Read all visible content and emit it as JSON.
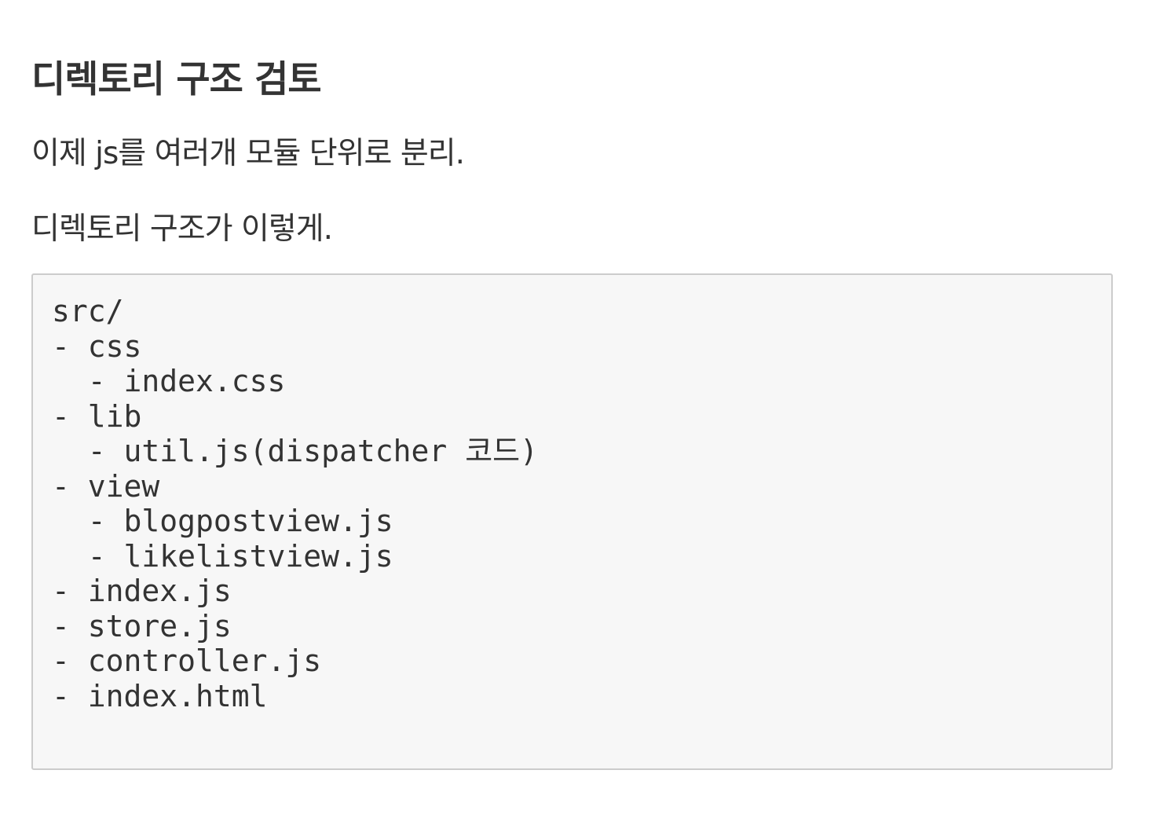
{
  "heading": "디렉토리 구조 검토",
  "paragraphs": [
    "이제 js를 여러개 모듈 단위로 분리.",
    "디렉토리 구조가 이렇게."
  ],
  "code_lines": [
    "src/",
    "- css",
    "  - index.css",
    "- lib",
    "  - util.js(dispatcher 코드)",
    "- view",
    "  - blogpostview.js",
    "  - likelistview.js",
    "- index.js",
    "- store.js",
    "- controller.js",
    "- index.html"
  ]
}
